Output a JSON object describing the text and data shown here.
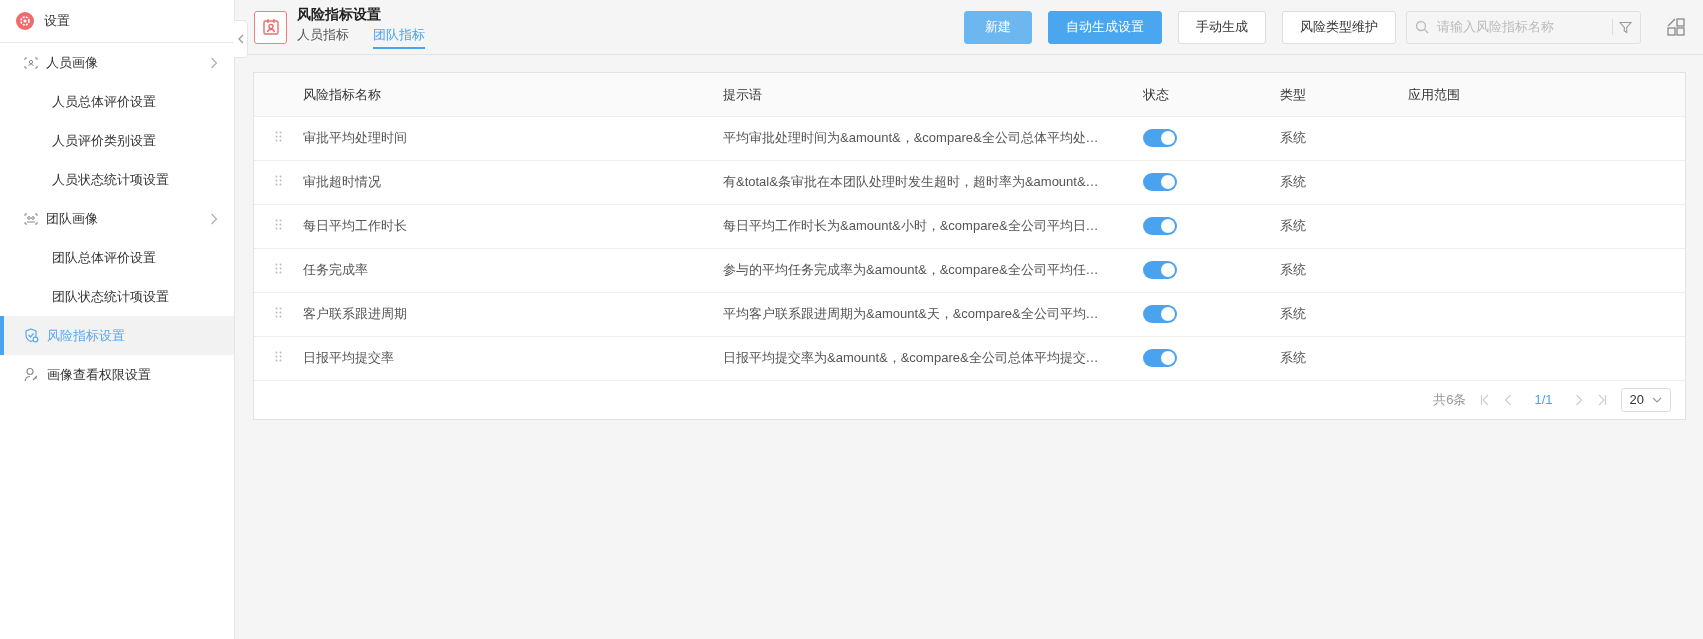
{
  "sidebar": {
    "title": "设置",
    "items": [
      {
        "label": "人员画像",
        "kind": "group",
        "selected": false,
        "children": [
          {
            "label": "人员总体评价设置",
            "selected": false
          },
          {
            "label": "人员评价类别设置",
            "selected": false
          },
          {
            "label": "人员状态统计项设置",
            "selected": false
          }
        ]
      },
      {
        "label": "团队画像",
        "kind": "group",
        "selected": false,
        "children": [
          {
            "label": "团队总体评价设置",
            "selected": false
          },
          {
            "label": "团队状态统计项设置",
            "selected": false
          }
        ]
      },
      {
        "label": "风险指标设置",
        "kind": "item",
        "selected": true
      },
      {
        "label": "画像查看权限设置",
        "kind": "item",
        "selected": false
      }
    ]
  },
  "header": {
    "title": "风险指标设置",
    "tabs": [
      {
        "label": "人员指标",
        "selected": false
      },
      {
        "label": "团队指标",
        "selected": true
      }
    ],
    "buttons": [
      {
        "label": "新建",
        "kind": "primary-light"
      },
      {
        "label": "自动生成设置",
        "kind": "primary"
      },
      {
        "label": "手动生成",
        "kind": "default"
      },
      {
        "label": "风险类型维护",
        "kind": "default"
      }
    ],
    "search": {
      "placeholder": "请输入风险指标名称"
    }
  },
  "table": {
    "columns": [
      "风险指标名称",
      "提示语",
      "状态",
      "类型",
      "应用范围"
    ],
    "rows": [
      {
        "name": "审批平均处理时间",
        "hint": "平均审批处理时间为&amount&，&compare&全公司总体平均处…",
        "on": true,
        "type": "系统"
      },
      {
        "name": "审批超时情况",
        "hint": "有&total&条审批在本团队处理时发生超时，超时率为&amount&…",
        "on": true,
        "type": "系统"
      },
      {
        "name": "每日平均工作时长",
        "hint": "每日平均工作时长为&amount&小时，&compare&全公司平均日…",
        "on": true,
        "type": "系统"
      },
      {
        "name": "任务完成率",
        "hint": "参与的平均任务完成率为&amount&，&compare&全公司平均任…",
        "on": true,
        "type": "系统"
      },
      {
        "name": "客户联系跟进周期",
        "hint": "平均客户联系跟进周期为&amount&天，&compare&全公司平均…",
        "on": true,
        "type": "系统"
      },
      {
        "name": "日报平均提交率",
        "hint": "日报平均提交率为&amount&，&compare&全公司总体平均提交…",
        "on": true,
        "type": "系统"
      }
    ]
  },
  "pagination": {
    "total": "共6条",
    "page": "1/1",
    "page_size": "20"
  }
}
